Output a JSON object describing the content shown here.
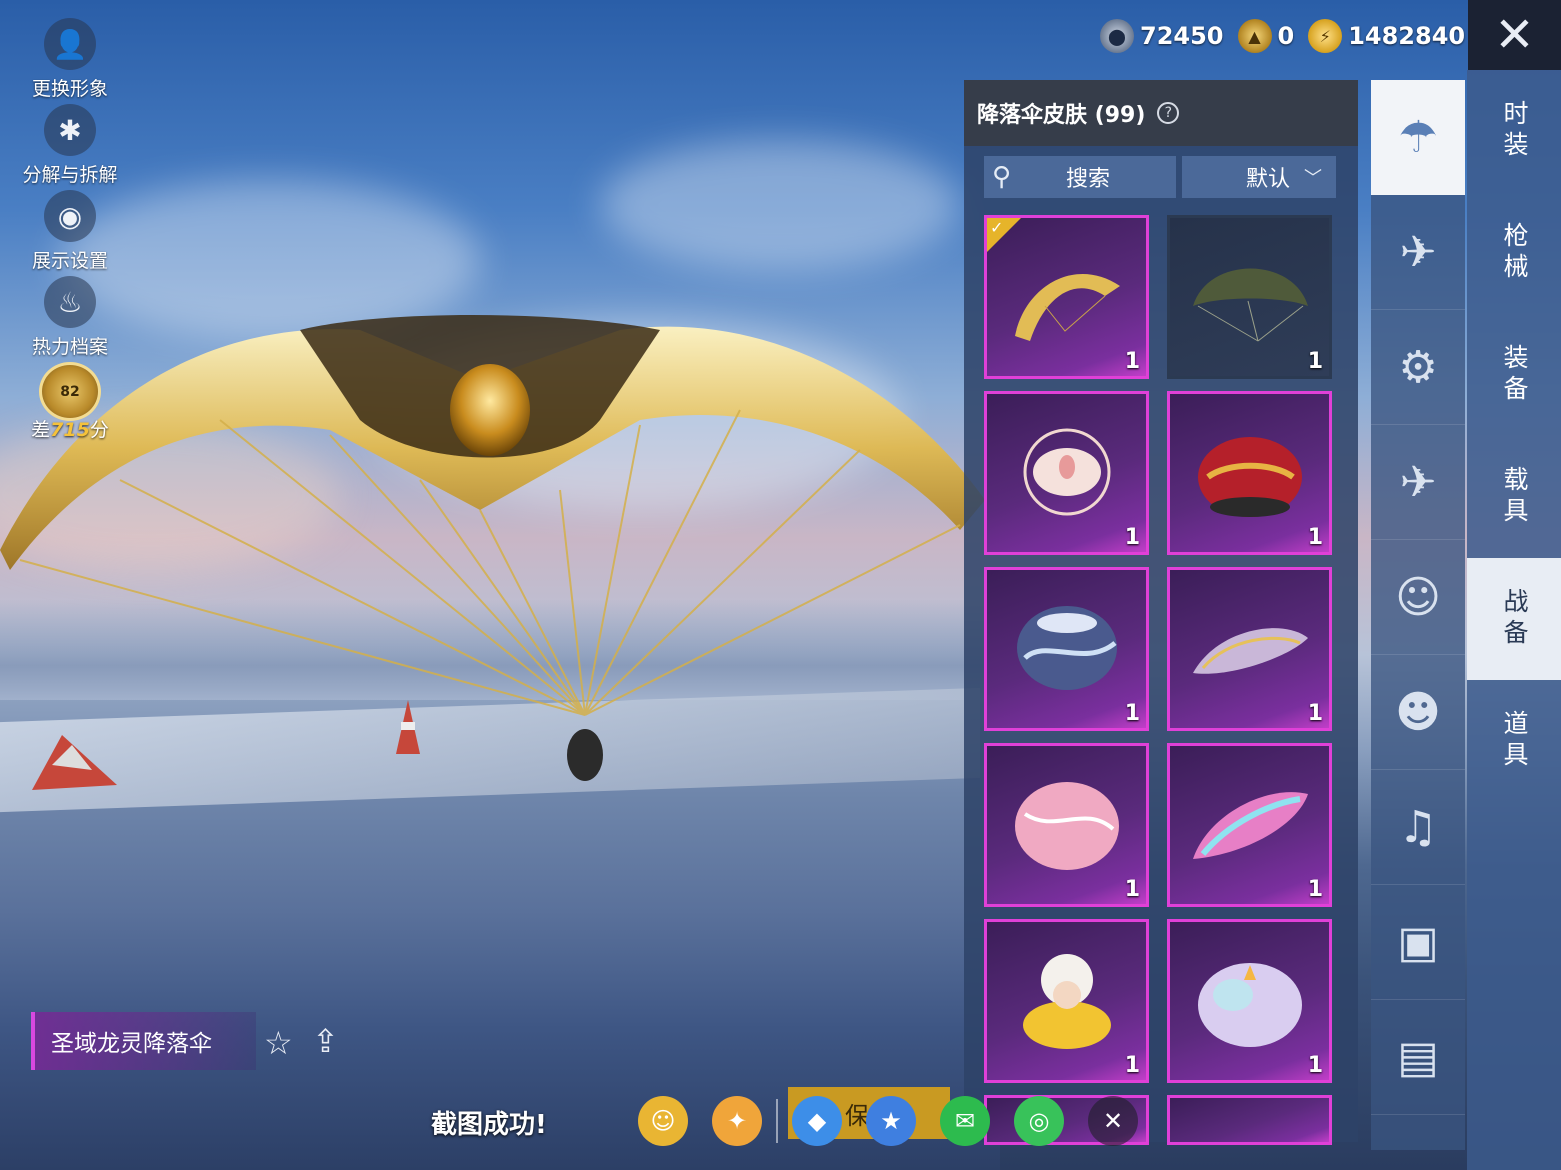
{
  "side_menu": [
    {
      "label": "更换形象",
      "icon": "avatar-icon"
    },
    {
      "label": "分解与拆解",
      "icon": "puzzle-icon"
    },
    {
      "label": "展示设置",
      "icon": "eye-icon"
    },
    {
      "label": "热力档案",
      "icon": "flame-icon"
    }
  ],
  "rank": {
    "level": "82",
    "prefix": "差",
    "points": "715",
    "suffix": "分"
  },
  "currencies": [
    {
      "value": "72450",
      "icon": "silver-coin-icon"
    },
    {
      "value": "0",
      "icon": "gold-token-icon"
    },
    {
      "value": "1482840",
      "icon": "bolt-coin-icon"
    }
  ],
  "categories": [
    "时装",
    "枪械",
    "装备",
    "载具",
    "战备",
    "道具"
  ],
  "active_category": "战备",
  "rail_icons": [
    "parachute-icon",
    "skydive-icon",
    "drone-icon",
    "plane-icon",
    "emote-icon",
    "robot-icon",
    "sound-icon",
    "chat-icon",
    "gallery-icon"
  ],
  "panel": {
    "title": "降落伞皮肤 (99)",
    "search_label": "搜索",
    "sort_label": "默认"
  },
  "items": [
    {
      "count": "1",
      "equipped": true,
      "rarity": "legendary"
    },
    {
      "count": "1",
      "equipped": false,
      "rarity": "common"
    },
    {
      "count": "1",
      "equipped": false,
      "rarity": "legendary"
    },
    {
      "count": "1",
      "equipped": false,
      "rarity": "legendary"
    },
    {
      "count": "1",
      "equipped": false,
      "rarity": "legendary"
    },
    {
      "count": "1",
      "equipped": false,
      "rarity": "legendary"
    },
    {
      "count": "1",
      "equipped": false,
      "rarity": "legendary"
    },
    {
      "count": "1",
      "equipped": false,
      "rarity": "legendary"
    },
    {
      "count": "1",
      "equipped": false,
      "rarity": "legendary"
    },
    {
      "count": "1",
      "equipped": false,
      "rarity": "legendary"
    }
  ],
  "selected_item_name": "圣域龙灵降落伞",
  "screenshot_toast": "截图成功!",
  "save_button": "保存",
  "share_targets": [
    "friends-icon",
    "peace-elite-icon",
    "qq-icon",
    "qzone-icon",
    "wechat-icon",
    "moments-icon",
    "close-icon"
  ]
}
